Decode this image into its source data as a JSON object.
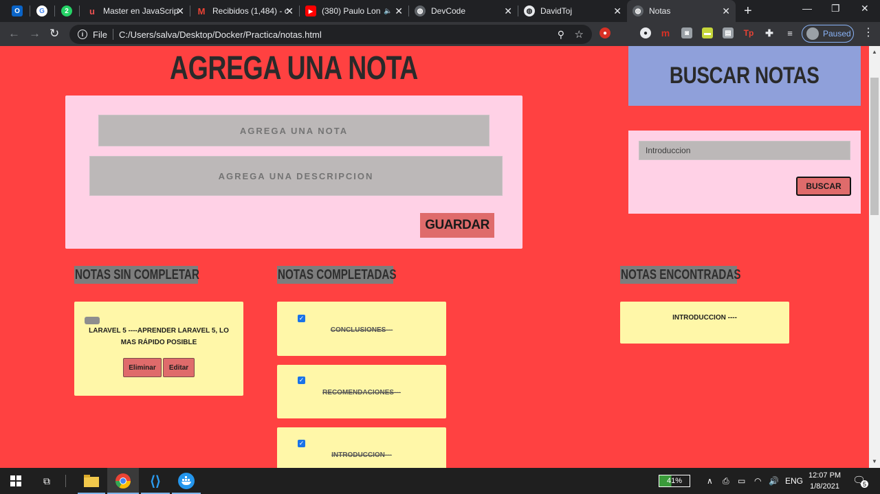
{
  "browser": {
    "tabs": [
      {
        "title": "",
        "icon": "outlook-icon",
        "color": "#0a64c8",
        "glyph": "O"
      },
      {
        "title": "",
        "icon": "google-icon",
        "color": "#ffffff",
        "glyph": "G"
      },
      {
        "title": "",
        "icon": "whatsapp-icon",
        "color": "#25d366",
        "glyph": "2"
      },
      {
        "title": "Master en JavaScrip",
        "icon": "udemy-icon",
        "color": "#ec5252",
        "glyph": "u"
      },
      {
        "title": "Recibidos (1,484) - c",
        "icon": "gmail-icon",
        "color": "#ea4335",
        "glyph": "M"
      },
      {
        "title": "(380) Paulo Lon",
        "icon": "youtube-icon",
        "color": "#ff0000",
        "glyph": "▶"
      },
      {
        "title": "DevCode",
        "icon": "globe-icon",
        "color": "#5f6368",
        "glyph": "◍"
      },
      {
        "title": "DavidToj",
        "icon": "globe-icon",
        "color": "#e8eaed",
        "glyph": "◍"
      },
      {
        "title": "Notas",
        "icon": "globe-icon",
        "color": "#5f6368",
        "glyph": "◍"
      }
    ],
    "address": {
      "scheme_label": "File",
      "url": "C:/Users/salva/Desktop/Docker/Practica/notas.html"
    },
    "profile_label": "Paused"
  },
  "page": {
    "add_title": "AGREGA UNA NOTA",
    "note_placeholder": "AGREGA UNA NOTA",
    "description_placeholder": "AGREGA UNA DESCRIPCION",
    "save_label": "GUARDAR",
    "search_title": "BUSCAR NOTAS",
    "search_value": "Introduccion",
    "search_label": "BUSCAR",
    "columns": {
      "pending": "NOTAS SIN COMPLETAR",
      "completed": "NOTAS COMPLETADAS",
      "found": "NOTAS ENCONTRADAS"
    },
    "pending_notes": [
      {
        "text": "LARAVEL 5 ----APRENDER LARAVEL 5, LO MAS RÁPIDO POSIBLE",
        "delete_label": "Eliminar",
        "edit_label": "Editar"
      }
    ],
    "completed_notes": [
      {
        "text": "CONCLUSIONES---",
        "checked": true
      },
      {
        "text": "RECOMENDACIONES---",
        "checked": true
      },
      {
        "text": "INTRODUCCION---",
        "checked": true
      }
    ],
    "found_notes": [
      {
        "text": "INTRODUCCION ----"
      }
    ],
    "colors": {
      "page_bg": "#ff4141",
      "panel_pink": "#ffd1e6",
      "search_header": "#8fa0da",
      "card_yellow": "#fff7a8",
      "button_red": "#df6b6b"
    }
  },
  "taskbar": {
    "battery": "41%",
    "language": "ENG",
    "time": "12:07 PM",
    "date": "1/8/2021",
    "notification_count": "5"
  }
}
